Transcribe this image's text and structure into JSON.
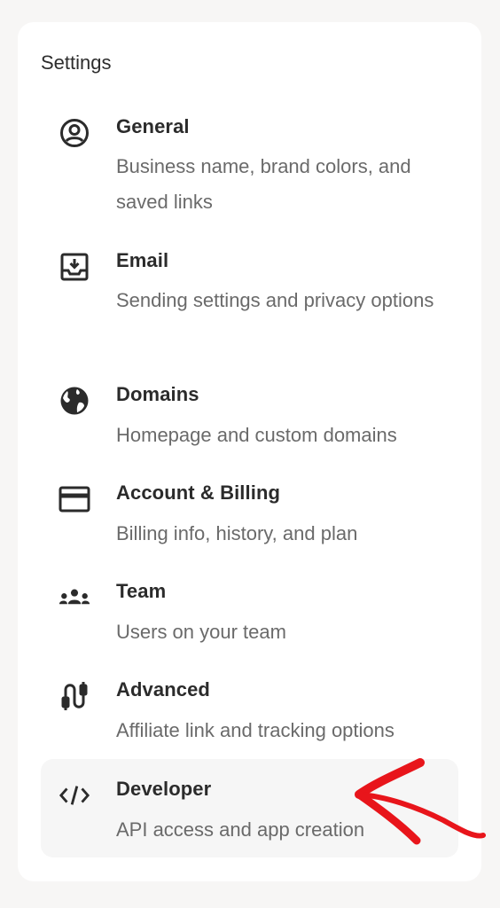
{
  "settings": {
    "title": "Settings",
    "items": [
      {
        "label": "General",
        "description": "Business name, brand colors, and saved links",
        "icon": "user-circle-icon"
      },
      {
        "label": "Email",
        "description": "Sending settings and privacy options",
        "icon": "inbox-download-icon"
      },
      {
        "label": "Domains",
        "description": "Homepage and custom domains",
        "icon": "globe-icon"
      },
      {
        "label": "Account & Billing",
        "description": "Billing info, history, and plan",
        "icon": "credit-card-icon"
      },
      {
        "label": "Team",
        "description": "Users on your team",
        "icon": "team-icon"
      },
      {
        "label": "Advanced",
        "description": "Affiliate link and tracking options",
        "icon": "cable-icon"
      },
      {
        "label": "Developer",
        "description": "API access and app creation",
        "icon": "code-icon",
        "selected": true
      }
    ]
  },
  "annotation": {
    "arrow_color": "#e8151b"
  }
}
